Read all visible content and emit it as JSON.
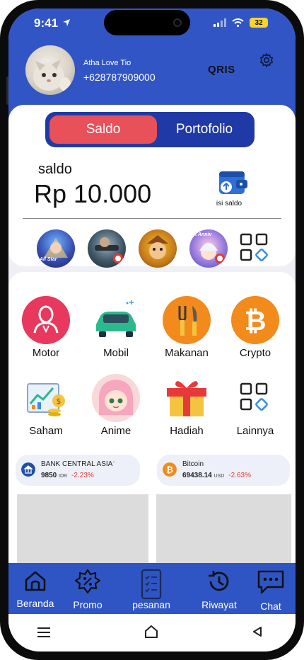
{
  "status_bar": {
    "time": "9:41",
    "battery": "32"
  },
  "user": {
    "name": "Atha Love Tio",
    "phone": "+628787909000"
  },
  "header": {
    "qris_label": "QRIS"
  },
  "tabs": [
    {
      "label": "Saldo",
      "active": true
    },
    {
      "label": "Portofolio",
      "active": false
    }
  ],
  "balance": {
    "label": "saldo",
    "value": "Rp 10.000",
    "topup_label": "isi saldo"
  },
  "games": [
    {
      "icon": "mobile-legends-icon",
      "caption": "All Star"
    },
    {
      "icon": "free-fire-icon",
      "caption": ""
    },
    {
      "icon": "clash-of-clans-icon",
      "caption": ""
    },
    {
      "icon": "anniversary-game-icon",
      "caption": "st Anniv"
    }
  ],
  "menu": [
    {
      "label": "Motor",
      "icon": "motor-driver-icon"
    },
    {
      "label": "Mobil",
      "icon": "car-icon"
    },
    {
      "label": "Makanan",
      "icon": "cutlery-icon"
    },
    {
      "label": "Crypto",
      "icon": "bitcoin-icon"
    },
    {
      "label": "Saham",
      "icon": "stock-chart-icon"
    },
    {
      "label": "Anime",
      "icon": "anime-girl-icon"
    },
    {
      "label": "Hadiah",
      "icon": "gift-icon"
    },
    {
      "label": "Lainnya",
      "icon": "grid-more-icon"
    }
  ],
  "tickers": [
    {
      "name": "BANK CENTRAL ASIA",
      "price": "9850",
      "unit": "IDR",
      "change": "-2.23%"
    },
    {
      "name": "Bitcoin",
      "price": "69438.14",
      "unit": "USD",
      "change": "-2.63%"
    }
  ],
  "bottom_nav": [
    {
      "label": "Beranda",
      "icon": "home-icon"
    },
    {
      "label": "Promo",
      "icon": "promo-badge-icon"
    },
    {
      "label": "pesanan",
      "icon": "order-list-icon"
    },
    {
      "label": "Riwayat",
      "icon": "history-icon"
    },
    {
      "label": "Chat",
      "icon": "chat-icon"
    }
  ],
  "colors": {
    "primary": "#3255c6",
    "accent": "#e8505a",
    "nav": "#2f55c4",
    "negative": "#e53935"
  }
}
